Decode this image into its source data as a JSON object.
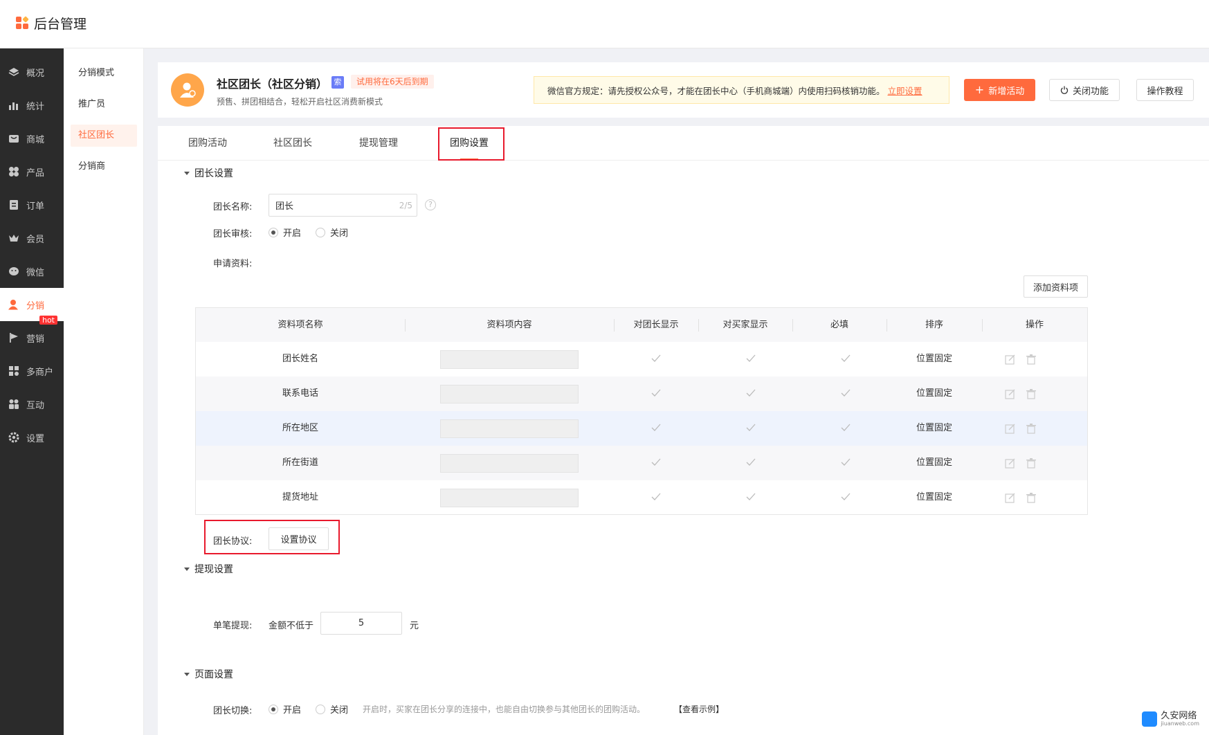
{
  "app": {
    "title": "后台管理"
  },
  "sidebar": {
    "items": [
      {
        "label": "概况",
        "icon": "layers-icon"
      },
      {
        "label": "统计",
        "icon": "chart-icon"
      },
      {
        "label": "商城",
        "icon": "shop-icon"
      },
      {
        "label": "产品",
        "icon": "product-icon"
      },
      {
        "label": "订单",
        "icon": "order-icon"
      },
      {
        "label": "会员",
        "icon": "crown-icon"
      },
      {
        "label": "微信",
        "icon": "wechat-icon"
      },
      {
        "label": "分销",
        "icon": "user-icon",
        "active": true
      },
      {
        "label": "营销",
        "icon": "flag-icon",
        "badge": "hot"
      },
      {
        "label": "多商户",
        "icon": "merchant-icon"
      },
      {
        "label": "互动",
        "icon": "interact-icon"
      },
      {
        "label": "设置",
        "icon": "gear-icon"
      }
    ]
  },
  "subnav": {
    "items": [
      {
        "label": "分销模式"
      },
      {
        "label": "推广员"
      },
      {
        "label": "社区团长",
        "active": true
      },
      {
        "label": "分销商"
      }
    ]
  },
  "header": {
    "title": "社区团长（社区分销）",
    "badge": "索",
    "trial": "试用将在6天后到期",
    "subtitle": "预售、拼团相结合，轻松开启社区消费新模式",
    "notice": "微信官方规定：请先授权公众号，才能在团长中心（手机商城端）内使用扫码核销功能。",
    "notice_link": "立即设置",
    "btn_new": "新增活动",
    "btn_close": "关闭功能",
    "btn_tutorial": "操作教程"
  },
  "tabs": [
    {
      "label": "团购活动"
    },
    {
      "label": "社区团长"
    },
    {
      "label": "提现管理"
    },
    {
      "label": "团购设置",
      "active": true
    }
  ],
  "leader": {
    "section": "团长设置",
    "name_label": "团长名称:",
    "name_value": "团长",
    "name_counter": "2/5",
    "audit_label": "团长审核:",
    "audit_on": "开启",
    "audit_off": "关闭",
    "apply_label": "申请资料:",
    "add_btn": "添加资料项",
    "agreement_label": "团长协议:",
    "agreement_btn": "设置协议"
  },
  "table": {
    "columns": [
      "资料项名称",
      "资料项内容",
      "对团长显示",
      "对买家显示",
      "必填",
      "排序",
      "操作"
    ],
    "rows": [
      {
        "name": "团长姓名",
        "sort": "位置固定"
      },
      {
        "name": "联系电话",
        "sort": "位置固定"
      },
      {
        "name": "所在地区",
        "sort": "位置固定"
      },
      {
        "name": "所在街道",
        "sort": "位置固定"
      },
      {
        "name": "提货地址",
        "sort": "位置固定"
      }
    ]
  },
  "withdraw": {
    "section": "提现设置",
    "label": "单笔提现:",
    "prefix": "金额不低于",
    "value": "5",
    "unit": "元"
  },
  "page": {
    "section": "页面设置",
    "switch_label": "团长切换:",
    "on": "开启",
    "off": "关闭",
    "hint": "开启时，买家在团长分享的连接中，也能自由切换参与其他团长的团购活动。",
    "example": "【查看示例】"
  },
  "watermark": {
    "text": "久安网络",
    "sub": "jiuanweb.com"
  },
  "colors": {
    "accent": "#ff6a3d",
    "sidebar": "#2b2b2b",
    "highlight_box": "#e8192c"
  }
}
